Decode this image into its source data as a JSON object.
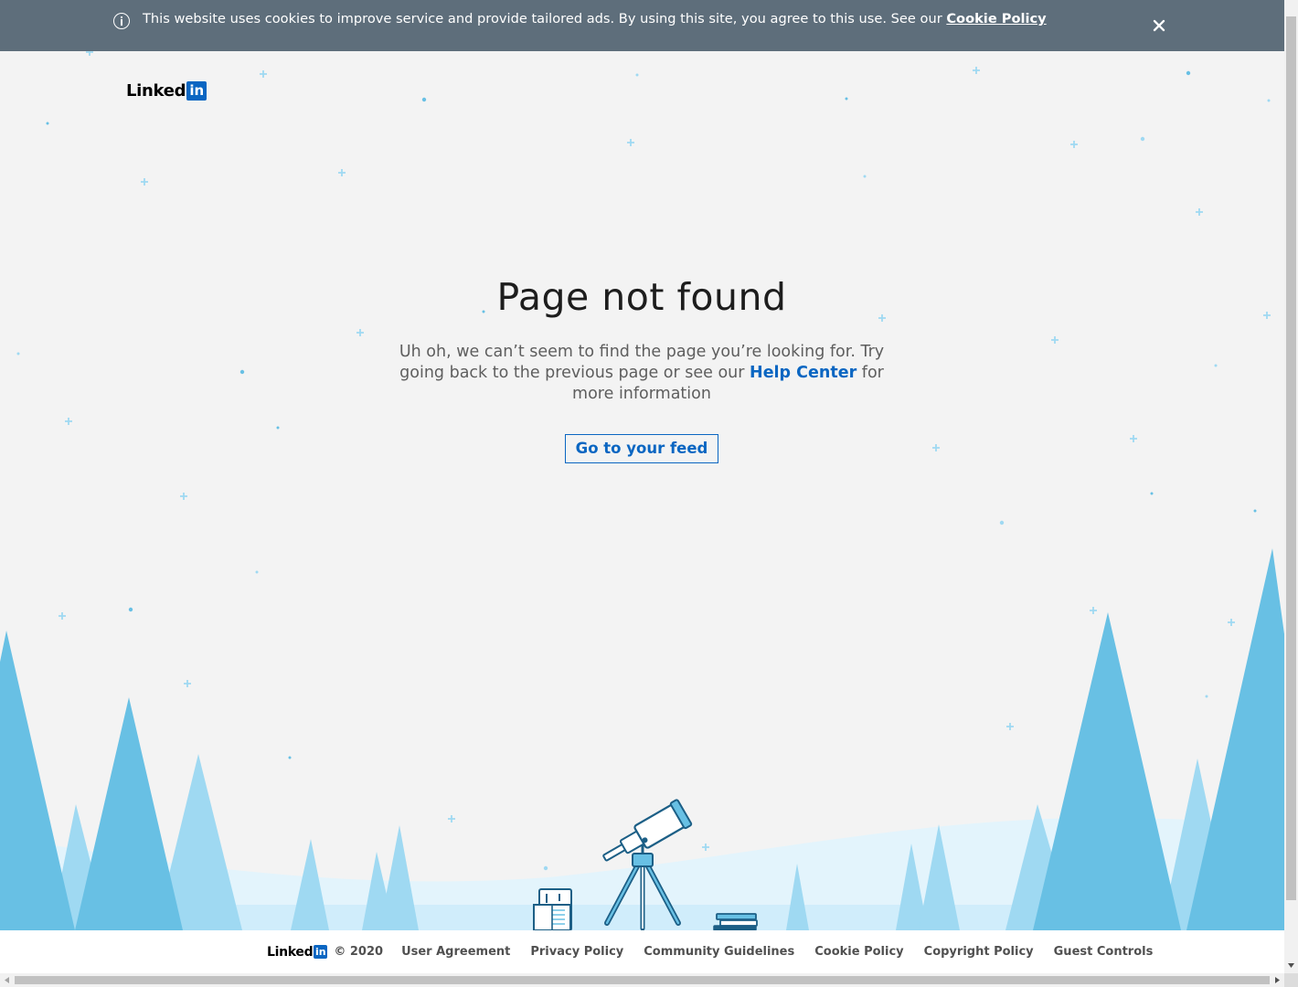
{
  "cookie_banner": {
    "message": "This website uses cookies to improve service and provide tailored ads. By using this site, you agree to this use. See our",
    "link_label": "Cookie Policy",
    "close_label": "×",
    "info_icon": "info-icon",
    "color": "#5e6e7b"
  },
  "header": {
    "logo_word": "Linked",
    "logo_in": "in"
  },
  "main": {
    "title": "Page not found",
    "message_part1": "Uh oh, we can’t seem to find the page you’re looking for. Try going back to the previous page or see our",
    "help_link": "Help Center",
    "message_part2": "for more information",
    "feed_button": "Go to your feed"
  },
  "footer": {
    "logo_word": "Linked",
    "logo_in": "in",
    "copyright": "© 2020",
    "links": [
      "User Agreement",
      "Privacy Policy",
      "Community Guidelines",
      "Cookie Policy",
      "Copyright Policy",
      "Guest Controls"
    ]
  },
  "illustration": {
    "icons": [
      "telescope-icon",
      "books-icon",
      "tree-icon",
      "star-icon"
    ]
  },
  "colors": {
    "brand": "#0a66c2",
    "tree_dark": "#68c0e4",
    "tree_light": "#9fd9f2",
    "ground": "#e3f4fc",
    "background": "#f3f3f3"
  }
}
